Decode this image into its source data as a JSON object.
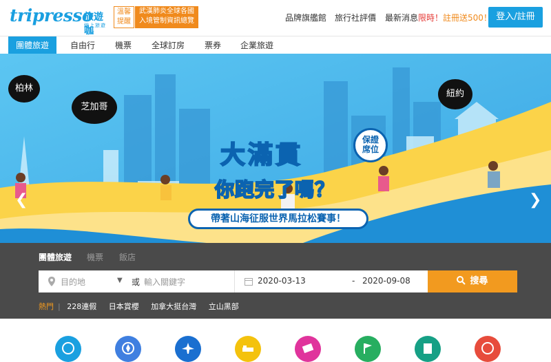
{
  "header": {
    "logo_word": "tripresso",
    "logo_cn": "旅遊咖",
    "logo_sub": "線上旅遊平台",
    "alert_tag": "溫馨\n提醒",
    "alert_text": "武漢肺炎全球各國\n入境管制資訊總覽",
    "nav": [
      "品牌旗艦館",
      "旅行社評價"
    ],
    "promo_prefix": "最新消息",
    "promo_red": "限時！",
    "promo_orange": "註冊送500！",
    "login_label": "登入/註冊"
  },
  "tabs": [
    {
      "label": "團體旅遊",
      "active": true
    },
    {
      "label": "自由行",
      "active": false
    },
    {
      "label": "機票",
      "active": false
    },
    {
      "label": "全球訂房",
      "active": false
    },
    {
      "label": "票券",
      "active": false
    },
    {
      "label": "企業旅遊",
      "active": false
    }
  ],
  "banner": {
    "bubbles": [
      "柏林",
      "芝加哥",
      "紐約"
    ],
    "headline": "大滿貫",
    "headline2": "你跑完了嗎？",
    "pill": "帶著山海征服世界馬拉松賽事！",
    "stamp": "保證\n席位",
    "prev_icon": "chevron-left-icon",
    "next_icon": "chevron-right-icon"
  },
  "search": {
    "tabs": [
      {
        "label": "團體旅遊",
        "active": true
      },
      {
        "label": "機票",
        "active": false
      },
      {
        "label": "飯店",
        "active": false
      }
    ],
    "destination_placeholder": "目的地",
    "or_label": "或",
    "keyword_placeholder": "輸入關鍵字",
    "date_from": "2020-03-13",
    "date_sep": "-",
    "date_to": "2020-09-08",
    "search_label": "搜尋",
    "hot_label": "熱門",
    "hot_items": [
      "228連假",
      "日本賞櫻",
      "加拿大挺台灣",
      "立山黑部"
    ]
  },
  "categories": [
    {
      "icon": "globe-icon",
      "color": "#1aa0e0"
    },
    {
      "icon": "compass-icon",
      "color": "#3f7fe0"
    },
    {
      "icon": "airplane-icon",
      "color": "#1a6fd0"
    },
    {
      "icon": "bed-icon",
      "color": "#f4c20d"
    },
    {
      "icon": "ticket-icon",
      "color": "#e0349c"
    },
    {
      "icon": "flag-icon",
      "color": "#27ae60"
    },
    {
      "icon": "book-icon",
      "color": "#16a085"
    },
    {
      "icon": "coin-icon",
      "color": "#e74c3c"
    }
  ],
  "colors": {
    "accent": "#1aa0e0",
    "orange": "#f29a1f",
    "panel": "#4a4a4a"
  }
}
